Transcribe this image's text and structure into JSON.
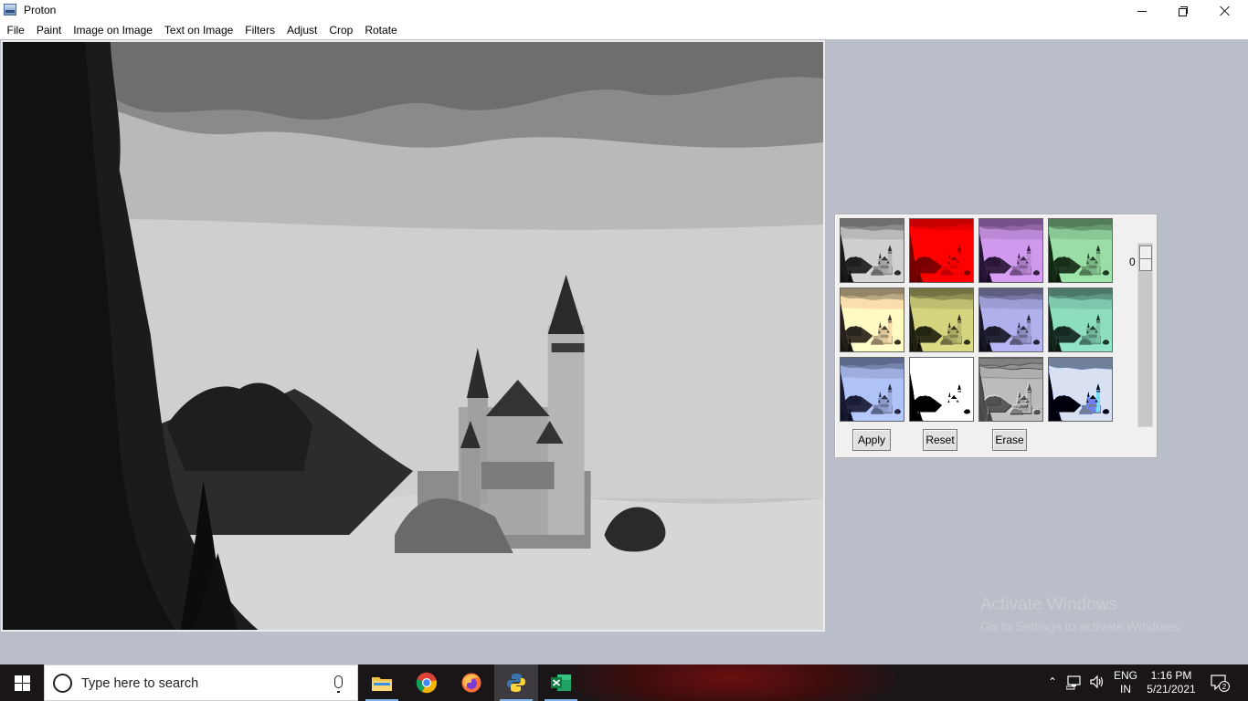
{
  "window": {
    "title": "Proton",
    "app_icon": "proton-app-icon",
    "controls": [
      "minimize-icon",
      "restore-icon",
      "close-icon"
    ]
  },
  "menu": [
    "File",
    "Paint",
    "Image on Image",
    "Text on Image",
    "Filters",
    "Adjust",
    "Crop",
    "Rotate"
  ],
  "canvas": {
    "image": "grayscale castle above clouds",
    "image_filter": "grayscale"
  },
  "filter_panel": {
    "thumbnail_filters": [
      "grayscale",
      "red-tint",
      "purple-tint",
      "green-tint",
      "sepia",
      "yellow-tint",
      "blue-violet-tint",
      "teal-tint",
      "blur",
      "edge-sketch",
      "emboss",
      "posterize"
    ],
    "buttons": {
      "apply": "Apply",
      "reset": "Reset",
      "erase": "Erase"
    },
    "slider": {
      "value": "0",
      "min": 0,
      "max": 100
    }
  },
  "watermark": {
    "title": "Activate Windows",
    "subtitle": "Go to Settings to activate Windows."
  },
  "taskbar": {
    "search_placeholder": "Type here to search",
    "apps": [
      "file-explorer-icon",
      "chrome-icon",
      "firefox-icon",
      "python-icon",
      "excel-icon"
    ],
    "lang_line1": "ENG",
    "lang_line2": "IN",
    "time": "1:16 PM",
    "date": "5/21/2021",
    "notification_count": "2"
  }
}
